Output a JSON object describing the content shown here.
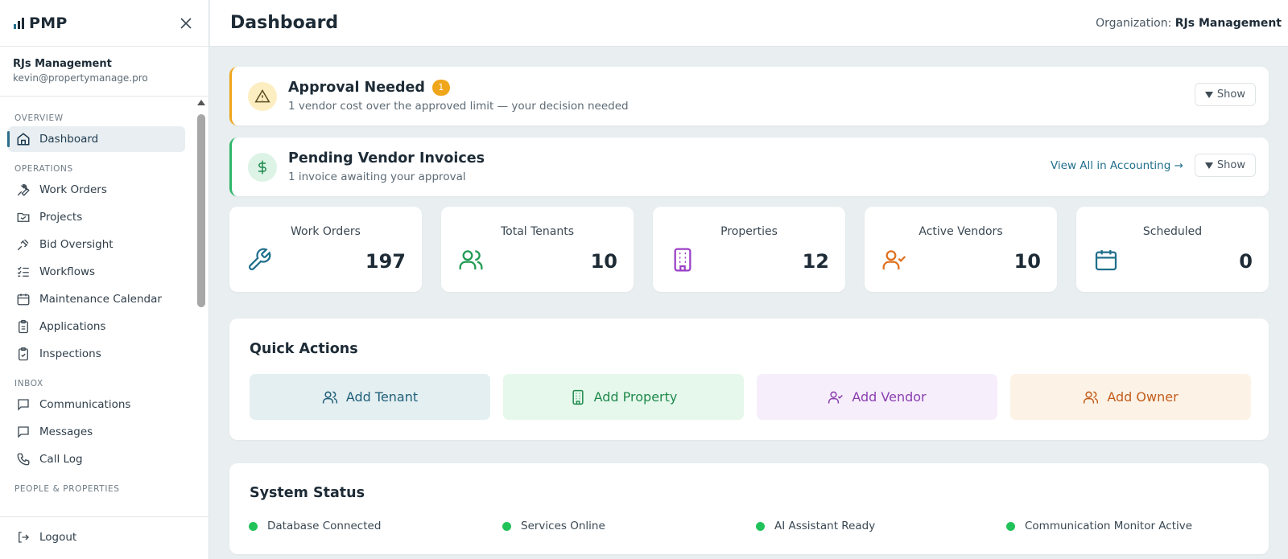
{
  "sidebar": {
    "logo_text": "PMP",
    "org_name": "RJs Management",
    "user_email": "kevin@propertymanage.pro",
    "sections": {
      "overview": "OVERVIEW",
      "operations": "OPERATIONS",
      "inbox": "INBOX",
      "people": "PEOPLE & PROPERTIES"
    },
    "items": {
      "dashboard": "Dashboard",
      "work_orders": "Work Orders",
      "projects": "Projects",
      "bid_oversight": "Bid Oversight",
      "workflows": "Workflows",
      "maintenance_calendar": "Maintenance Calendar",
      "applications": "Applications",
      "inspections": "Inspections",
      "communications": "Communications",
      "messages": "Messages",
      "call_log": "Call Log"
    },
    "logout": "Logout",
    "active_color": "#2c6e8a"
  },
  "header": {
    "title": "Dashboard",
    "org_prefix": "Organization:",
    "org_name": "RJs Management"
  },
  "approval": {
    "title": "Approval Needed",
    "count": "1",
    "subtitle": "1 vendor cost over the approved limit — your decision needed",
    "show_label": "Show",
    "accent": "#f0a61a"
  },
  "invoices": {
    "title": "Pending Vendor Invoices",
    "subtitle": "1 invoice awaiting your approval",
    "link": "View All in Accounting →",
    "show_label": "Show",
    "accent": "#2eb86a"
  },
  "stats": [
    {
      "label": "Work Orders",
      "value": "197",
      "icon": "wrench-icon",
      "color": "#1f6f8b"
    },
    {
      "label": "Total Tenants",
      "value": "10",
      "icon": "users-icon",
      "color": "#1f9a52"
    },
    {
      "label": "Properties",
      "value": "12",
      "icon": "building-icon",
      "color": "#9b3fc7"
    },
    {
      "label": "Active Vendors",
      "value": "10",
      "icon": "user-check-icon",
      "color": "#e0701c"
    },
    {
      "label": "Scheduled",
      "value": "0",
      "icon": "calendar-icon",
      "color": "#1f6f8b"
    }
  ],
  "quick_actions": {
    "title": "Quick Actions",
    "add_tenant": "Add Tenant",
    "add_property": "Add Property",
    "add_vendor": "Add Vendor",
    "add_owner": "Add Owner"
  },
  "system_status": {
    "title": "System Status",
    "items": [
      "Database Connected",
      "Services Online",
      "AI Assistant Ready",
      "Communication Monitor Active"
    ],
    "ok_color": "#22c25a"
  }
}
